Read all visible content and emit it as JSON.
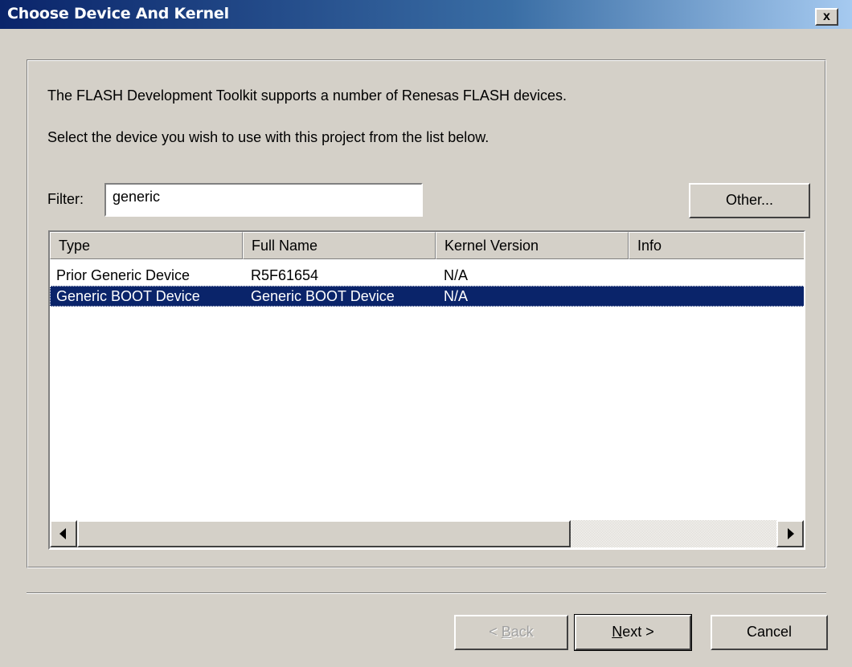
{
  "window": {
    "title": "Choose Device And Kernel",
    "close_label": "x"
  },
  "intro": {
    "line1": "The FLASH Development Toolkit supports a number of Renesas FLASH devices.",
    "line2": "Select the device you wish to use with this project from the list below."
  },
  "filter": {
    "label": "Filter:",
    "value": "generic"
  },
  "other_button": "Other...",
  "list": {
    "columns": [
      "Type",
      "Full Name",
      "Kernel Version",
      "Info"
    ],
    "rows": [
      {
        "type": "Prior Generic Device",
        "full_name": "R5F61654",
        "kernel_version": "N/A",
        "info": "",
        "selected": false
      },
      {
        "type": "Generic BOOT Device",
        "full_name": "Generic BOOT Device",
        "kernel_version": "N/A",
        "info": "",
        "selected": true
      }
    ]
  },
  "buttons": {
    "back_prefix": "< ",
    "back_mnemonic": "B",
    "back_rest": "ack",
    "next_mnemonic": "N",
    "next_rest": "ext >",
    "cancel": "Cancel"
  },
  "icons": {
    "close": "close-icon",
    "scroll_left": "arrow-left-icon",
    "scroll_right": "arrow-right-icon"
  },
  "colors": {
    "titlebar_start": "#0a246a",
    "titlebar_end": "#a6caf0",
    "dialog_bg": "#d4d0c8",
    "selection_bg": "#0a246a"
  }
}
